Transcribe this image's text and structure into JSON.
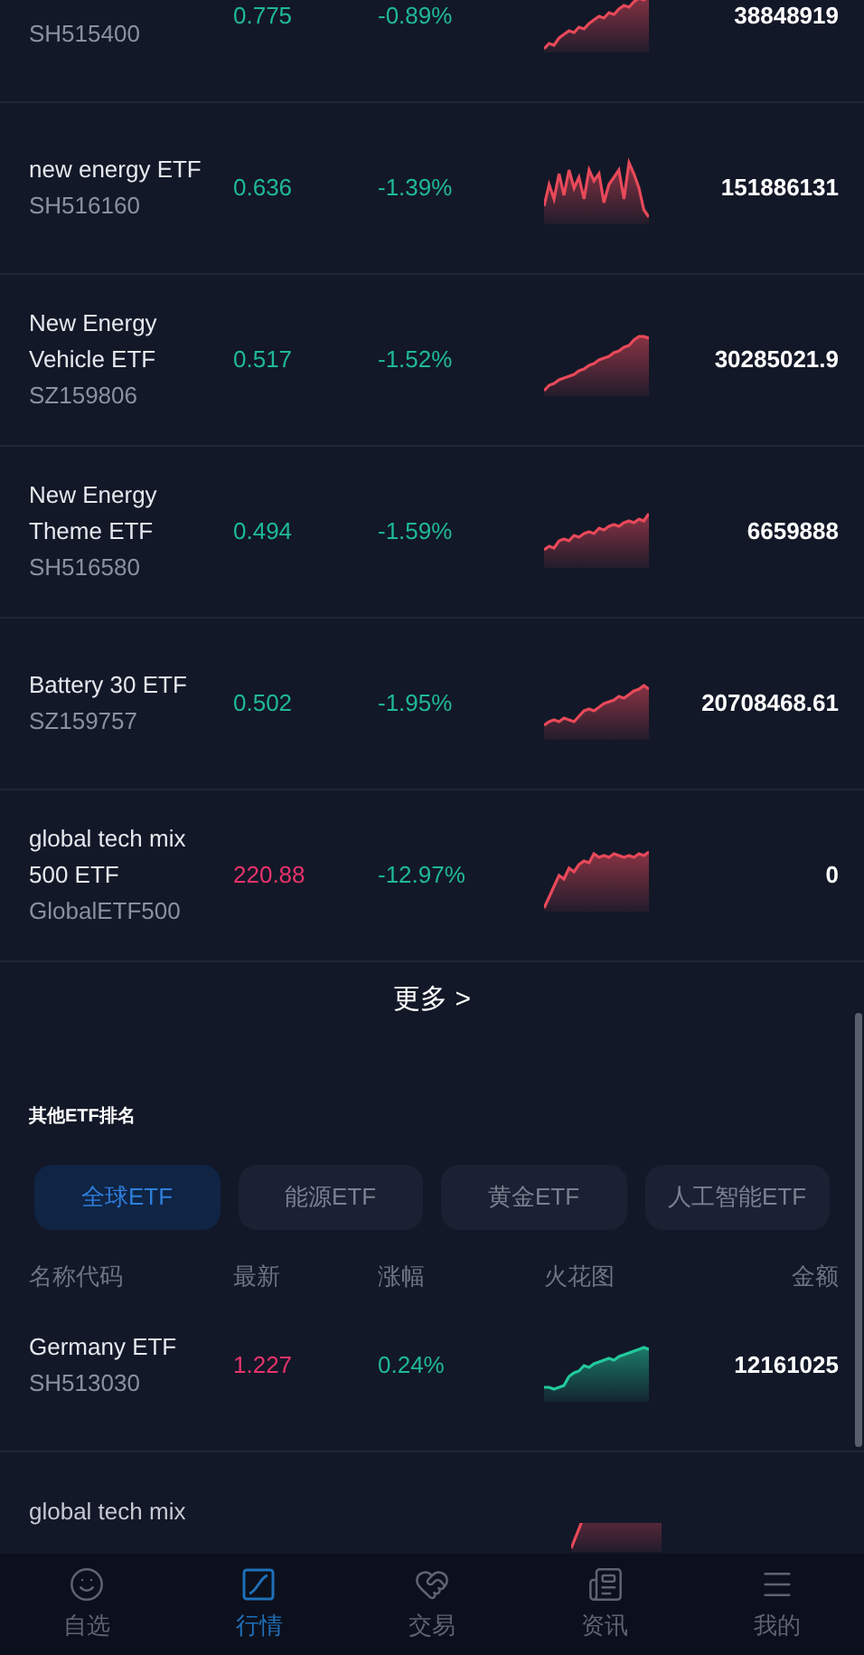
{
  "top_rows": [
    {
      "code": "SH515400",
      "price": "0.775",
      "price_up": false,
      "change": "-0.89%",
      "change_up": false,
      "spark_up": true,
      "amount": "38848919"
    },
    {
      "name": "new energy ETF",
      "code": "SH516160",
      "price": "0.636",
      "price_up": false,
      "change": "-1.39%",
      "change_up": false,
      "spark_up": true,
      "amount": "151886131"
    },
    {
      "name": "New Energy Vehicle ETF",
      "code": "SZ159806",
      "price": "0.517",
      "price_up": false,
      "change": "-1.52%",
      "change_up": false,
      "spark_up": true,
      "amount": "30285021.9"
    },
    {
      "name": "New Energy Theme ETF",
      "code": "SH516580",
      "price": "0.494",
      "price_up": false,
      "change": "-1.59%",
      "change_up": false,
      "spark_up": true,
      "amount": "6659888"
    },
    {
      "name": "Battery 30 ETF",
      "code": "SZ159757",
      "price": "0.502",
      "price_up": false,
      "change": "-1.95%",
      "change_up": false,
      "spark_up": true,
      "amount": "20708468.61"
    },
    {
      "name": "global tech mix 500 ETF",
      "code": "GlobalETF500",
      "price": "220.88",
      "price_up": true,
      "change": "-12.97%",
      "change_up": false,
      "spark_up": true,
      "amount": "0"
    }
  ],
  "more_link": "更多 >",
  "section_title": "其他ETF排名",
  "category_tabs": [
    {
      "label": "全球ETF",
      "selected": true
    },
    {
      "label": "能源ETF",
      "selected": false
    },
    {
      "label": "黄金ETF",
      "selected": false
    },
    {
      "label": "人工智能ETF",
      "selected": false
    }
  ],
  "table": {
    "columns": [
      "名称代码",
      "最新",
      "涨幅",
      "火花图",
      "金额"
    ],
    "rows": [
      {
        "name": "Germany ETF",
        "code": "SH513030",
        "price": "1.227",
        "price_up": true,
        "change": "0.24%",
        "change_up": false,
        "spark_up": false,
        "amount": "12161025"
      },
      {
        "name": "global tech mix",
        "spark_up": true
      }
    ]
  },
  "bottom_nav": [
    {
      "label": "自选",
      "selected": false
    },
    {
      "label": "行情",
      "selected": true
    },
    {
      "label": "交易",
      "selected": false
    },
    {
      "label": "资讯",
      "selected": false
    },
    {
      "label": "我的",
      "selected": false
    }
  ]
}
